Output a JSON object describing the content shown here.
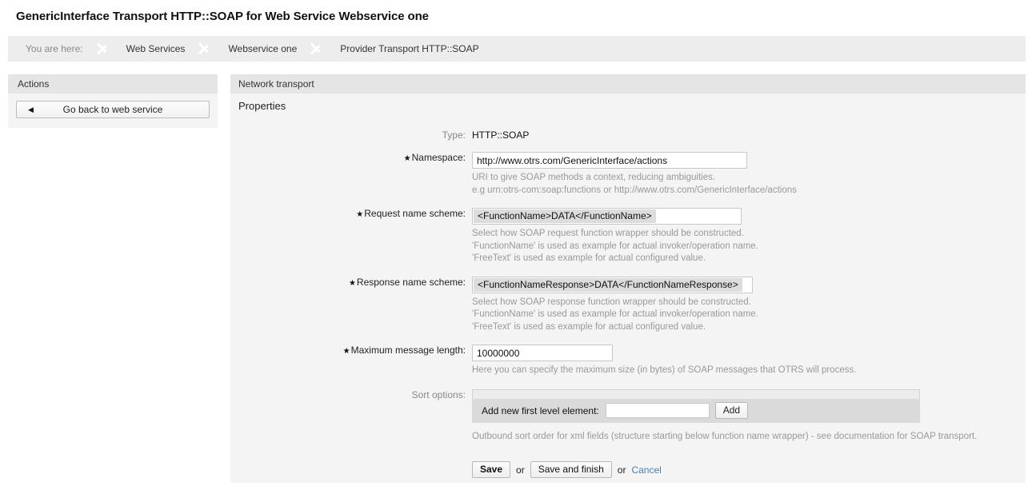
{
  "page_title": "GenericInterface Transport HTTP::SOAP for Web Service Webservice one",
  "breadcrumb": {
    "prefix": "You are here:",
    "items": [
      "Web Services",
      "Webservice one",
      "Provider Transport HTTP::SOAP"
    ]
  },
  "sidebar": {
    "header": "Actions",
    "back_button": {
      "label": "Go back to web service",
      "icon": "◀"
    }
  },
  "content": {
    "header": "Network transport",
    "section_title": "Properties",
    "fields": {
      "type": {
        "label": "Type:",
        "value": "HTTP::SOAP"
      },
      "namespace": {
        "label": "Namespace:",
        "required": true,
        "value": "http://www.otrs.com/GenericInterface/actions",
        "placeholder": "",
        "help": [
          "URI to give SOAP methods a context, reducing ambiguities.",
          "e.g urn:otrs-com:soap:functions or http://www.otrs.com/GenericInterface/actions"
        ]
      },
      "request_name_scheme": {
        "label": "Request name scheme:",
        "required": true,
        "selected": "<FunctionName>DATA</FunctionName>",
        "help": [
          "Select how SOAP request function wrapper should be constructed.",
          "'FunctionName' is used as example for actual invoker/operation name.",
          "'FreeText' is used as example for actual configured value."
        ]
      },
      "response_name_scheme": {
        "label": "Response name scheme:",
        "required": true,
        "selected": "<FunctionNameResponse>DATA</FunctionNameResponse>",
        "help": [
          "Select how SOAP response function wrapper should be constructed.",
          "'FunctionName' is used as example for actual invoker/operation name.",
          "'FreeText' is used as example for actual configured value."
        ]
      },
      "maximum_message_length": {
        "label": "Maximum message length:",
        "required": true,
        "value": "10000000",
        "placeholder": "",
        "help": [
          "Here you can specify the maximum size (in bytes) of SOAP messages that OTRS will process."
        ]
      },
      "sort_options": {
        "label": "Sort options:",
        "required": false,
        "add_label": "Add new first level element:",
        "add_input_value": "",
        "add_input_placeholder": "",
        "add_button": "Add",
        "help": [
          "Outbound sort order for xml fields (structure starting below function name wrapper) - see documentation for SOAP transport."
        ]
      }
    },
    "actions": {
      "save": "Save",
      "or_1": "or",
      "save_and_finish": "Save and finish",
      "or_2": "or",
      "cancel": "Cancel"
    }
  },
  "colors": {
    "link": "#4e7fa6",
    "panel_header": "#e5e5e5",
    "panel_body": "#f4f4f4",
    "breadcrumb_bg": "#ededed",
    "sort_panel_bg": "#dadada"
  }
}
